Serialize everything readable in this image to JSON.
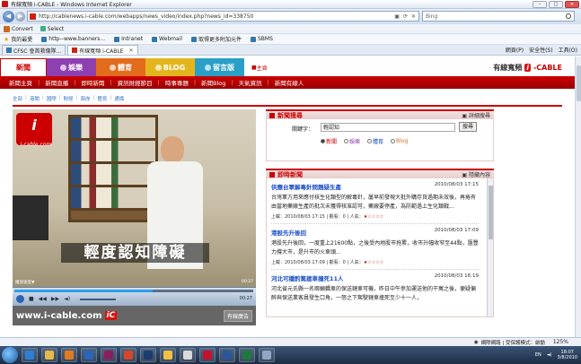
{
  "window": {
    "title": "有線寬頻 i-CABLE - Windows Internet Explorer"
  },
  "addressbar": {
    "url": "http://cablenews.i-cable.com/webapps/news_video/index.php?news_id=338750",
    "search_placeholder": "Bing"
  },
  "toolbar2": {
    "convert": "Convert",
    "select": "Select"
  },
  "favorites": {
    "label": "我的最愛",
    "items": [
      "CFSC 義務救傷隊...",
      "http--www.banners...",
      "Intranet",
      "Webmail",
      "取得更多附加元件",
      "SBMS"
    ]
  },
  "tabs": {
    "items": [
      "CFSC 會首救傷隊...",
      "有線寬頻 i-CABLE"
    ],
    "commands": [
      "網頁(P)",
      "安全性(S)",
      "工具(O)"
    ]
  },
  "site": {
    "nav": [
      {
        "label": "新聞",
        "color": "#ffffff"
      },
      {
        "label": "娛樂",
        "color": "#8e3fb0"
      },
      {
        "label": "體育",
        "color": "#e36c1c"
      },
      {
        "label": "BLOG",
        "color": "#e4b61e"
      },
      {
        "label": "留言版",
        "color": "#2aa0c8"
      }
    ],
    "home": "主頁",
    "brand_text": "有線寬頻",
    "brand_logo": "i",
    "brand_cable": "-CABLE",
    "subnav": [
      "新聞主頁",
      "新聞直播",
      "即時新聞",
      "資訊財經節目",
      "時事專題",
      "新聞Blog",
      "天氣資訊",
      "新聞有線人"
    ],
    "subnav_active": "即時新聞",
    "categories": [
      "全部",
      "港聞",
      "國際",
      "財經",
      "兩岸",
      "體育",
      "通識"
    ]
  },
  "video": {
    "logo": "i",
    "logo_sub": "i-cable.com",
    "caption": "輕度認知障礙",
    "time_left": "播放速度▼",
    "time_right": "00:27",
    "ctrl_time": "00:27",
    "progress": 0.58,
    "footer_url": "www.i-cable.com",
    "footer_logo": "iC",
    "ad": "有線廣告"
  },
  "newssearch": {
    "title": "新聞搜尋",
    "advanced": "詳細搜尋",
    "keyword_label": "關鍵字：",
    "keyword_value": "輕認知",
    "button": "搜尋",
    "options": [
      "新聞",
      "娛樂",
      "體育",
      "Blog"
    ],
    "selected": "新聞"
  },
  "feed": {
    "title": "即時新聞",
    "hide": "隱藏內容",
    "items": [
      {
        "title": "供應台軍解毒針問題疑生產",
        "date": "2010/08/03 17:15",
        "body": "台灣軍方用來應付核生化類型的解毒針，屢早前發現大批外購存貨過期未效後，再捲有由當地藥廠生產的批次未獲得核准認可，藥廠要停產，為防範過上生化類戰...",
        "meta": "上載：2010/08/03 17:15 | 觀看：0 | 人氣：",
        "stars": "★☆☆☆☆"
      },
      {
        "title": "港股先升後回",
        "date": "2010/08/03 17:09",
        "body": "港股先升後回，一度重上21600點，之後受內地股市拖累，收市升幅收窄至44點，匯豐力撐大市，是升市的火車頭...",
        "meta": "上載：2010/08/03 17:09 | 觀看：0 | 人氣：",
        "stars": "★☆☆☆☆"
      },
      {
        "title": "河北可穩酌篤建車撞死11人",
        "date": "2010/08/03 16:19",
        "body": "河北省元氏縣一名兩輛轎車的保送鏈車可機，昨日中午參加運送他的干寓之後，便疑偏醉與保送業客員發生口角，一怒之下駕駛鏈車撞死至少十一人，",
        "meta": "",
        "stars": ""
      }
    ]
  },
  "status": {
    "zone": "網際網路 | 受保護模式：啟動",
    "zoom": "125%"
  },
  "tray": {
    "time": "18:07",
    "date": "3/8/2010"
  }
}
